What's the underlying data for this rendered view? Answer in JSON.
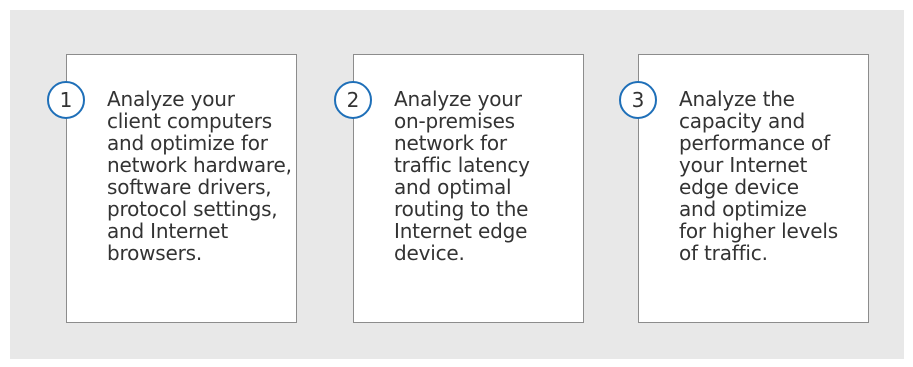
{
  "steps": [
    {
      "number": "1",
      "text": "Analyze your\nclient computers\nand optimize for\nnetwork hardware,\nsoftware drivers,\nprotocol settings,\nand Internet\nbrowsers."
    },
    {
      "number": "2",
      "text": "Analyze your\non-premises\nnetwork for\ntraffic latency\nand optimal\nrouting to the\nInternet edge\ndevice."
    },
    {
      "number": "3",
      "text": "Analyze the\ncapacity and\nperformance of\nyour Internet\nedge device\nand optimize\nfor higher levels\nof traffic."
    }
  ],
  "colors": {
    "background_panel": "#e8e8e8",
    "card": "#ffffff",
    "card_border": "#8c8c8c",
    "circle_accent": "#1e6fb8",
    "text": "#333333"
  }
}
